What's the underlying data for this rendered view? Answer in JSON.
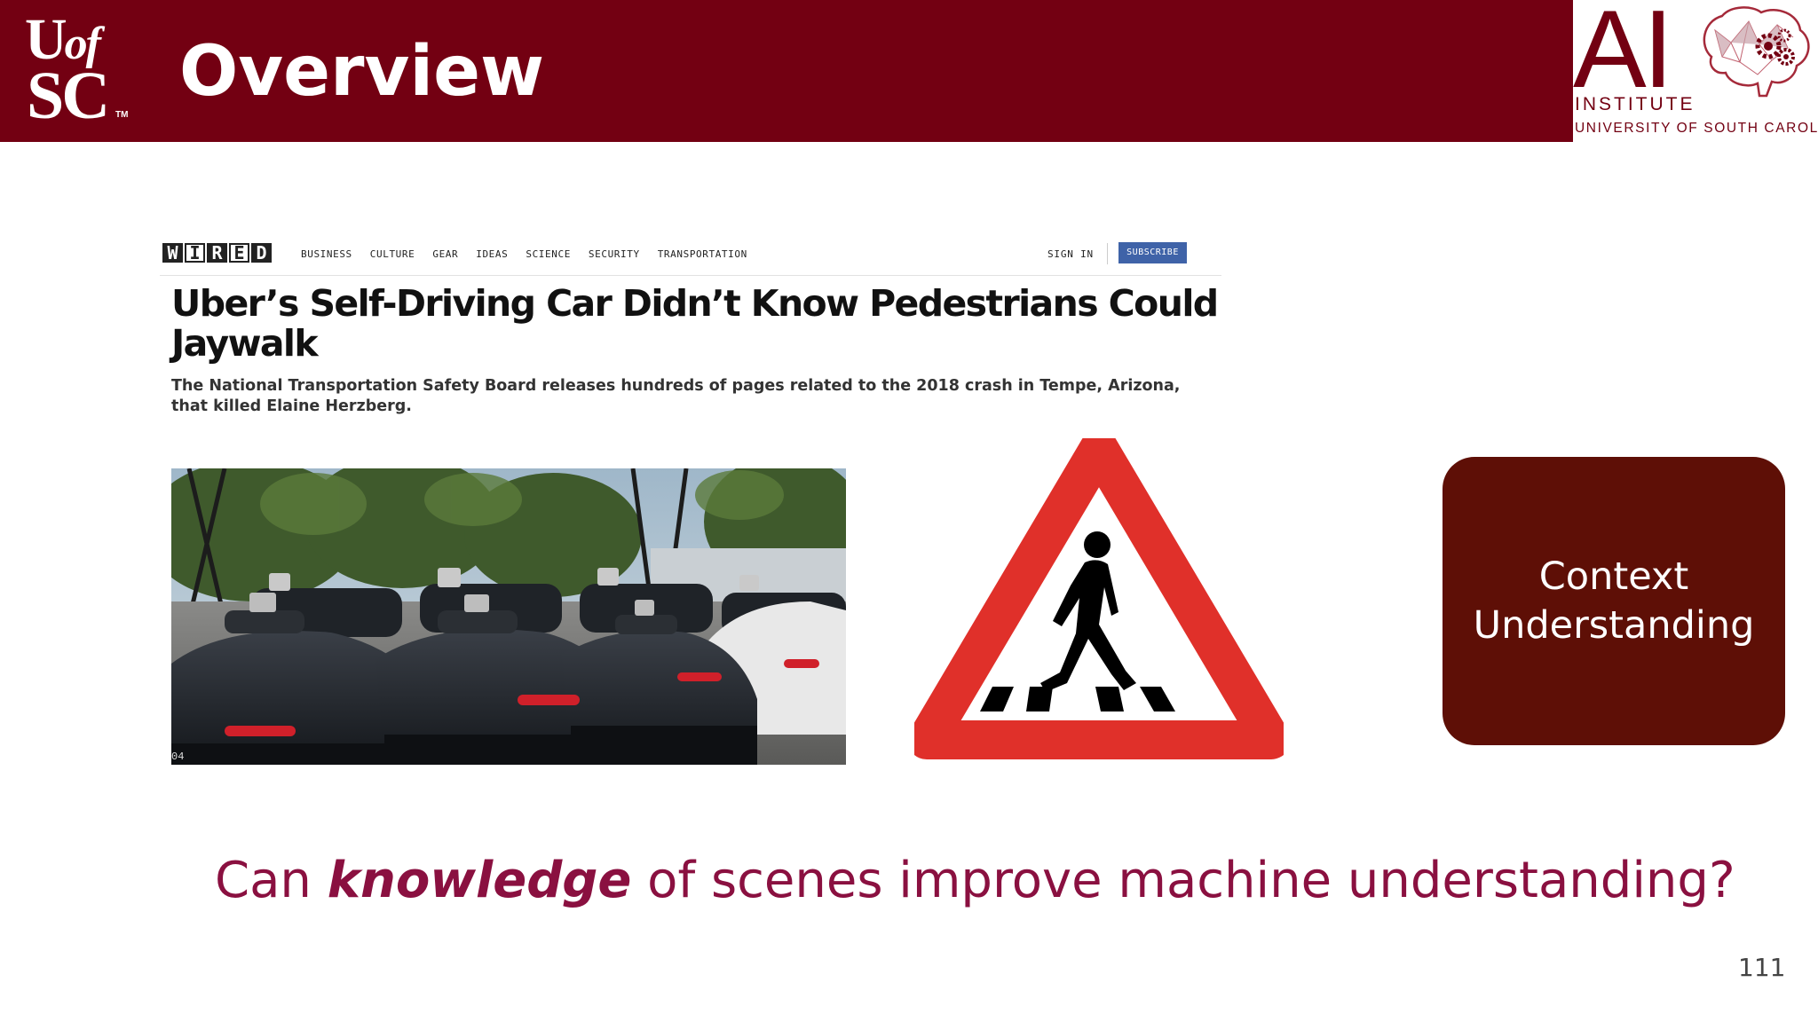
{
  "header": {
    "logo_line1": "U",
    "logo_line1_small": "of",
    "logo_line2": "SC",
    "logo_tm": "TM",
    "title": "Overview",
    "ai_logo": {
      "big": "AI",
      "institute": "INSTITUTE",
      "university": "UNIVERSITY OF SOUTH CAROLINA"
    }
  },
  "article": {
    "brand_letters": [
      "W",
      "I",
      "R",
      "E",
      "D"
    ],
    "nav": [
      "BUSINESS",
      "CULTURE",
      "GEAR",
      "IDEAS",
      "SCIENCE",
      "SECURITY",
      "TRANSPORTATION"
    ],
    "sign_in": "SIGN IN",
    "subscribe": "SUBSCRIBE",
    "headline": "Uber’s Self-Driving Car Didn’t Know Pedestrians Could Jaywalk",
    "dek": "The National Transportation Safety Board releases hundreds of pages related to the 2018 crash in Tempe, Arizona, that killed Elaine Herzberg.",
    "photo_corner_label": "04"
  },
  "context_box": {
    "label": "Context\nUnderstanding"
  },
  "question": {
    "before": "Can ",
    "emphasis": "knowledge",
    "after": " of scenes improve machine understanding?"
  },
  "page_number": "111",
  "colors": {
    "header_bg": "#730012",
    "context_bg": "#5e0f06",
    "question_text": "#8a1040",
    "sign_red": "#e0302a",
    "subscribe_bg": "#3f63a8"
  }
}
